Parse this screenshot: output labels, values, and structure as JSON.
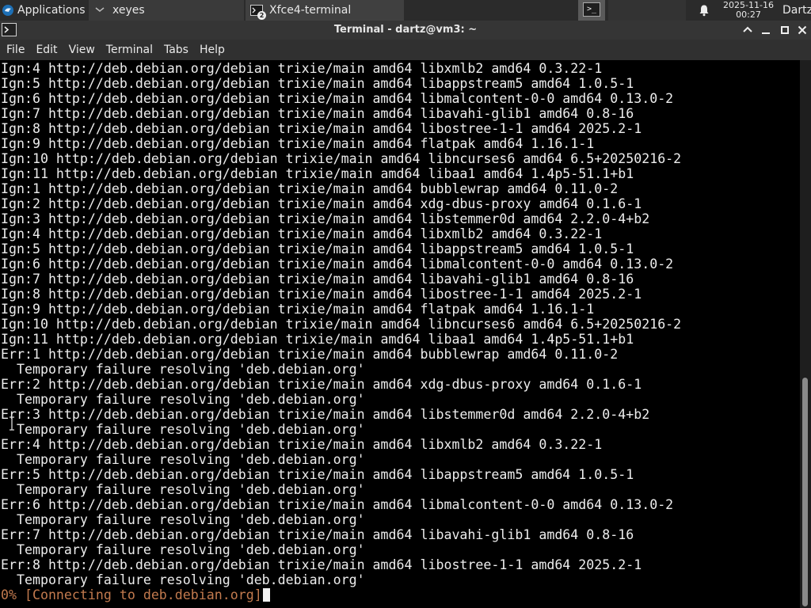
{
  "panel": {
    "applications_label": "Applications",
    "tasks": [
      {
        "label": "xeyes"
      },
      {
        "label": "Xfce4-terminal",
        "badge": "2"
      }
    ],
    "clock_date": "2025-11-16",
    "clock_time": "00:27",
    "user": "Dartz"
  },
  "window": {
    "title": "Terminal - dartz@vm3: ~"
  },
  "menu": {
    "items": [
      "File",
      "Edit",
      "View",
      "Terminal",
      "Tabs",
      "Help"
    ]
  },
  "terminal": {
    "lines": [
      "Ign:4 http://deb.debian.org/debian trixie/main amd64 libxmlb2 amd64 0.3.22-1",
      "Ign:5 http://deb.debian.org/debian trixie/main amd64 libappstream5 amd64 1.0.5-1",
      "Ign:6 http://deb.debian.org/debian trixie/main amd64 libmalcontent-0-0 amd64 0.13.0-2",
      "Ign:7 http://deb.debian.org/debian trixie/main amd64 libavahi-glib1 amd64 0.8-16",
      "Ign:8 http://deb.debian.org/debian trixie/main amd64 libostree-1-1 amd64 2025.2-1",
      "Ign:9 http://deb.debian.org/debian trixie/main amd64 flatpak amd64 1.16.1-1",
      "Ign:10 http://deb.debian.org/debian trixie/main amd64 libncurses6 amd64 6.5+20250216-2",
      "Ign:11 http://deb.debian.org/debian trixie/main amd64 libaa1 amd64 1.4p5-51.1+b1",
      "Ign:1 http://deb.debian.org/debian trixie/main amd64 bubblewrap amd64 0.11.0-2",
      "Ign:2 http://deb.debian.org/debian trixie/main amd64 xdg-dbus-proxy amd64 0.1.6-1",
      "Ign:3 http://deb.debian.org/debian trixie/main amd64 libstemmer0d amd64 2.2.0-4+b2",
      "Ign:4 http://deb.debian.org/debian trixie/main amd64 libxmlb2 amd64 0.3.22-1",
      "Ign:5 http://deb.debian.org/debian trixie/main amd64 libappstream5 amd64 1.0.5-1",
      "Ign:6 http://deb.debian.org/debian trixie/main amd64 libmalcontent-0-0 amd64 0.13.0-2",
      "Ign:7 http://deb.debian.org/debian trixie/main amd64 libavahi-glib1 amd64 0.8-16",
      "Ign:8 http://deb.debian.org/debian trixie/main amd64 libostree-1-1 amd64 2025.2-1",
      "Ign:9 http://deb.debian.org/debian trixie/main amd64 flatpak amd64 1.16.1-1",
      "Ign:10 http://deb.debian.org/debian trixie/main amd64 libncurses6 amd64 6.5+20250216-2",
      "Ign:11 http://deb.debian.org/debian trixie/main amd64 libaa1 amd64 1.4p5-51.1+b1",
      "Err:1 http://deb.debian.org/debian trixie/main amd64 bubblewrap amd64 0.11.0-2",
      "  Temporary failure resolving 'deb.debian.org'",
      "Err:2 http://deb.debian.org/debian trixie/main amd64 xdg-dbus-proxy amd64 0.1.6-1",
      "  Temporary failure resolving 'deb.debian.org'",
      "Err:3 http://deb.debian.org/debian trixie/main amd64 libstemmer0d amd64 2.2.0-4+b2",
      "  Temporary failure resolving 'deb.debian.org'",
      "Err:4 http://deb.debian.org/debian trixie/main amd64 libxmlb2 amd64 0.3.22-1",
      "  Temporary failure resolving 'deb.debian.org'",
      "Err:5 http://deb.debian.org/debian trixie/main amd64 libappstream5 amd64 1.0.5-1",
      "  Temporary failure resolving 'deb.debian.org'",
      "Err:6 http://deb.debian.org/debian trixie/main amd64 libmalcontent-0-0 amd64 0.13.0-2",
      "  Temporary failure resolving 'deb.debian.org'",
      "Err:7 http://deb.debian.org/debian trixie/main amd64 libavahi-glib1 amd64 0.8-16",
      "  Temporary failure resolving 'deb.debian.org'",
      "Err:8 http://deb.debian.org/debian trixie/main amd64 libostree-1-1 amd64 2025.2-1",
      "  Temporary failure resolving 'deb.debian.org'"
    ],
    "progress_line": "0% [Connecting to deb.debian.org]",
    "progress_color": "#c27a4e"
  }
}
